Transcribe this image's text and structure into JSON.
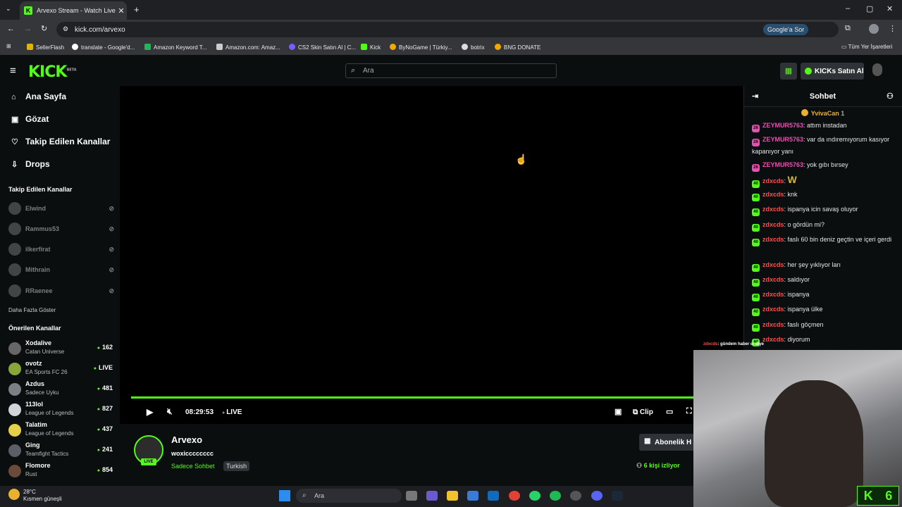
{
  "browser": {
    "tab_title": "Arvexo Stream - Watch Live on",
    "tab_close": "✕",
    "new_tab": "+",
    "url": "kick.com/arvexo",
    "google_sor": "Google'a Sor",
    "bookmarks": [
      {
        "label": "SellerFlash",
        "color": "#e0b30c"
      },
      {
        "label": "translate - Google'd...",
        "color": "#ffffff"
      },
      {
        "label": "Amazon Keyword T...",
        "color": "#1db954"
      },
      {
        "label": "Amazon.com: Amaz...",
        "color": "#cccccc"
      },
      {
        "label": "CS2 Skin Satın Al | C...",
        "color": "#7a5cff"
      },
      {
        "label": "Kick",
        "color": "#53fc18"
      },
      {
        "label": "ByNoGame | Türkiy...",
        "color": "#f2a900"
      },
      {
        "label": "botrix",
        "color": "#dddddd"
      },
      {
        "label": "BNG DONATE",
        "color": "#f2a900"
      }
    ],
    "all_bookmarks": "Tüm Yer İşaretleri"
  },
  "header": {
    "logo": "KICK",
    "logo_beta": "BETA",
    "search_placeholder": "Ara",
    "kicks_button": "KICKs Satın Al"
  },
  "sidebar": {
    "nav": [
      {
        "icon": "⌂",
        "label": "Ana Sayfa"
      },
      {
        "icon": "▣",
        "label": "Gözat"
      },
      {
        "icon": "♡",
        "label": "Takip Edilen Kanallar"
      },
      {
        "icon": "⇩",
        "label": "Drops"
      }
    ],
    "following_header": "Takip Edilen Kanallar",
    "following": [
      "Elwind",
      "Rammus53",
      "ilkerfirat",
      "Mithrain",
      "RRaenee"
    ],
    "show_more": "Daha Fazla Göster",
    "recommended_header": "Önerilen Kanallar",
    "recommended": [
      {
        "name": "Xodalive",
        "game": "Catan Universe",
        "viewers": "162"
      },
      {
        "name": "ovotz",
        "game": "EA Sports FC 26",
        "viewers": "LIVE"
      },
      {
        "name": "Azdus",
        "game": "Sadece Uyku",
        "viewers": "481"
      },
      {
        "name": "113lol",
        "game": "League of Legends",
        "viewers": "827"
      },
      {
        "name": "Talatim",
        "game": "League of Legends",
        "viewers": "437"
      },
      {
        "name": "Ging",
        "game": "Teamfight Tactics",
        "viewers": "241"
      },
      {
        "name": "Flomore",
        "game": "Rust",
        "viewers": "854"
      }
    ]
  },
  "player": {
    "time": "08:29:53",
    "live": "LIVE",
    "clip": "Clip"
  },
  "channel": {
    "name": "Arvexo",
    "title": "woxicccccccc",
    "category": "Sadece Sohbet",
    "tag": "Turkish",
    "live_badge": "LIVE",
    "subscribe": "Abonelik H",
    "viewers": "6 kişi izliyor"
  },
  "chat": {
    "header": "Sohbet",
    "pinned_user": "YvivaCan",
    "pinned_count": "1",
    "messages": [
      {
        "badge": "26",
        "badge_color": "#e84fb0",
        "user": "ZEYMUR5763",
        "user_color": "#e84fb0",
        "text": "attım instadan"
      },
      {
        "badge": "26",
        "badge_color": "#e84fb0",
        "user": "ZEYMUR5763",
        "user_color": "#e84fb0",
        "text": "var da ındıremıyorum kasıyor kapanıyor yanı"
      },
      {
        "badge": "26",
        "badge_color": "#e84fb0",
        "user": "ZEYMUR5763",
        "user_color": "#e84fb0",
        "text": "yok gıbı bırsey"
      },
      {
        "badge": "40",
        "badge_color": "#53fc18",
        "user": "zdxcds",
        "user_color": "#ff4d4d",
        "text": "W"
      },
      {
        "badge": "40",
        "badge_color": "#53fc18",
        "user": "zdxcds",
        "user_color": "#ff4d4d",
        "text": "knk"
      },
      {
        "badge": "40",
        "badge_color": "#53fc18",
        "user": "zdxcds",
        "user_color": "#ff4d4d",
        "text": "ispanya icin savaş oluyor"
      },
      {
        "badge": "40",
        "badge_color": "#53fc18",
        "user": "zdxcds",
        "user_color": "#ff4d4d",
        "text": "o gördün mi?"
      },
      {
        "badge": "40",
        "badge_color": "#53fc18",
        "user": "zdxcds",
        "user_color": "#ff4d4d",
        "text": "faslı 60 bin deniz geçtin ve içeri gerdi"
      },
      {
        "badge": "40",
        "badge_color": "#53fc18",
        "user": "zdxcds",
        "user_color": "#ff4d4d",
        "text": "her şey yıklıyor ları"
      },
      {
        "badge": "40",
        "badge_color": "#53fc18",
        "user": "zdxcds",
        "user_color": "#ff4d4d",
        "text": "saldıyor"
      },
      {
        "badge": "40",
        "badge_color": "#53fc18",
        "user": "zdxcds",
        "user_color": "#ff4d4d",
        "text": "ispanya"
      },
      {
        "badge": "40",
        "badge_color": "#53fc18",
        "user": "zdxcds",
        "user_color": "#ff4d4d",
        "text": "ispanya ülke"
      },
      {
        "badge": "40",
        "badge_color": "#53fc18",
        "user": "zdxcds",
        "user_color": "#ff4d4d",
        "text": "faslı göçmen"
      },
      {
        "badge": "40",
        "badge_color": "#53fc18",
        "user": "zdxcds",
        "user_color": "#ff4d4d",
        "text": "diyorum"
      }
    ]
  },
  "webcam": {
    "overlay_user": "zdxcds",
    "overlay_text": ": gündem haber ol diye",
    "counter_logo": "K",
    "counter_value": "6"
  },
  "taskbar": {
    "temperature": "28°C",
    "weather": "Kısmen güneşli",
    "search_placeholder": "Ara"
  }
}
